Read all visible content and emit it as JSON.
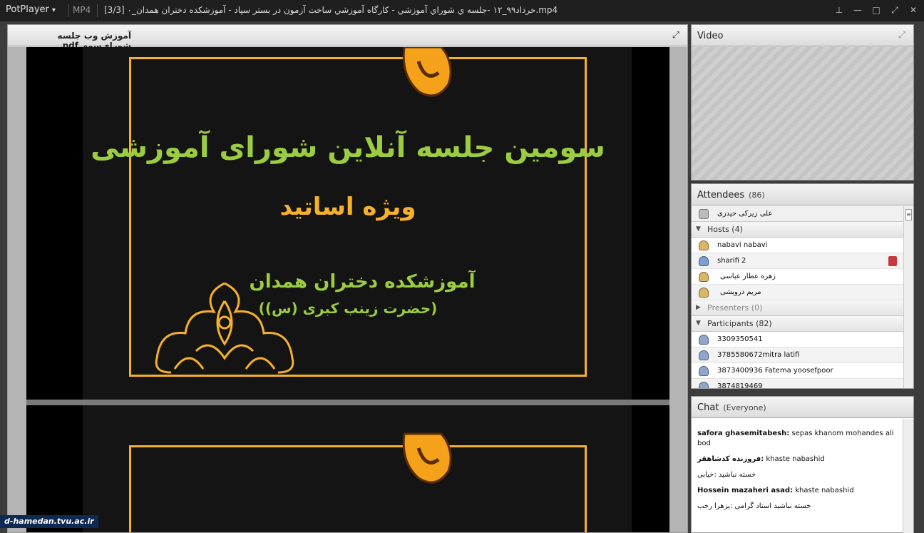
{
  "titlebar": {
    "app": "PotPlayer",
    "format": "MP4",
    "title": "[3/3]  ۰_خرداد۹۹_۱۲ -جلسه ي شوراي آموزشي - كارگاه آموزشي ساخت آزمون در بستر سپاد - آموزشكده دختران همدان.mp4"
  },
  "document": {
    "filename": "آموزش وب جلسه شورای‌سوم.pdf",
    "slide1": {
      "title": "سومین جلسه آنلاین شورای آموزشی",
      "subtitle": "ویژه اساتید",
      "org": "آموزشکده دختران همدان",
      "org_sub": "(حضرت زینب کبری (س))"
    }
  },
  "video": {
    "title": "Video"
  },
  "attendees": {
    "title": "Attendees",
    "count": "(86)",
    "me": "علی  زیرکی حیدری",
    "hosts": {
      "label": "Hosts (4)",
      "items": [
        "nabavi nabavi",
        "sharifi 2",
        "زهره  عطار عباسی",
        "مریم  درویشی"
      ]
    },
    "presenters": {
      "label": "Presenters (0)"
    },
    "participants": {
      "label": "Participants (82)",
      "items": [
        "3309350541",
        "3785580672mitra latifi",
        "3873400936  Fatema yoosefpoor",
        "3874819469"
      ]
    }
  },
  "chat": {
    "title": "Chat",
    "scope": "(Everyone)",
    "messages": [
      {
        "sender": "safora ghasemitabesh:",
        "text": " sepas khanom mohandes ali bod"
      },
      {
        "sender": "فروزنده کدشاهقر:",
        "text": " khaste  nabashid"
      },
      {
        "sender": "",
        "text": "خسته نباشید :خیابی"
      },
      {
        "sender": "Hossein mazaheri asad:",
        "text": " khaste  nabashid"
      },
      {
        "sender": "",
        "text": "خسته نباشید استاد گرامی :یزهرا رجب"
      }
    ]
  },
  "watermark": "d-hamedan.tvu.ac.ir",
  "colors": {
    "slide_gold": "#f5b12a",
    "slide_green": "#9ccc3f"
  }
}
